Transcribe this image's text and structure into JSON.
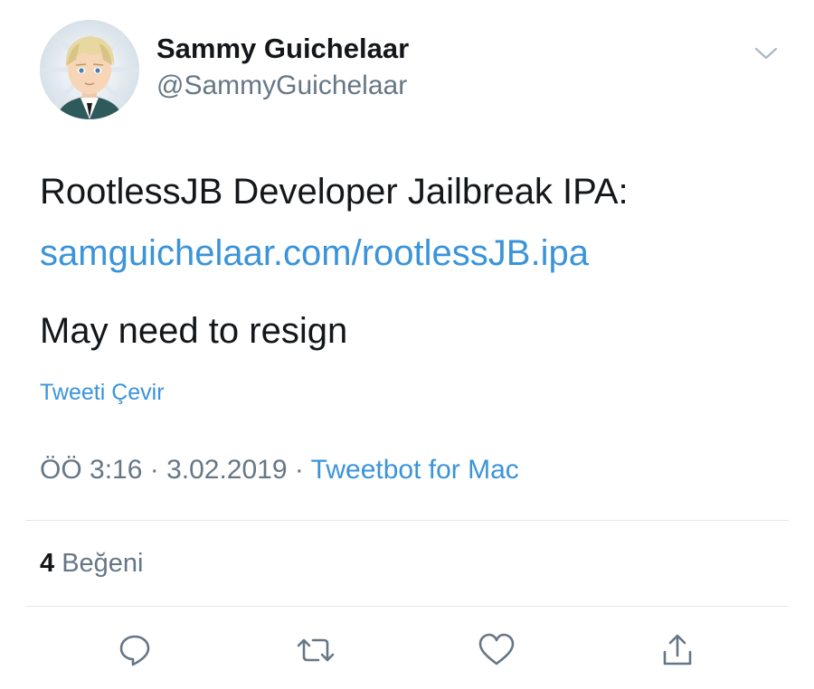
{
  "author": {
    "display_name": "Sammy Guichelaar",
    "handle": "@SammyGuichelaar"
  },
  "tweet": {
    "lines": [
      "RootlessJB Developer Jailbreak IPA:",
      "samguichelaar.com/rootlessJB.ipa",
      "May need to resign"
    ],
    "translate_label": "Tweeti Çevir"
  },
  "meta": {
    "time": "ÖÖ 3:16",
    "separator": " · ",
    "date": "3.02.2019",
    "source": "Tweetbot for Mac"
  },
  "stats": {
    "likes_count": "4",
    "likes_label": "Beğeni"
  },
  "icons": {
    "caret": "chevron-down-icon",
    "reply": "reply-icon",
    "retweet": "retweet-icon",
    "like": "heart-icon",
    "share": "share-icon"
  },
  "colors": {
    "text": "#14171a",
    "secondary": "#657786",
    "link": "#3b94d9",
    "divider": "#e1e8ed"
  }
}
